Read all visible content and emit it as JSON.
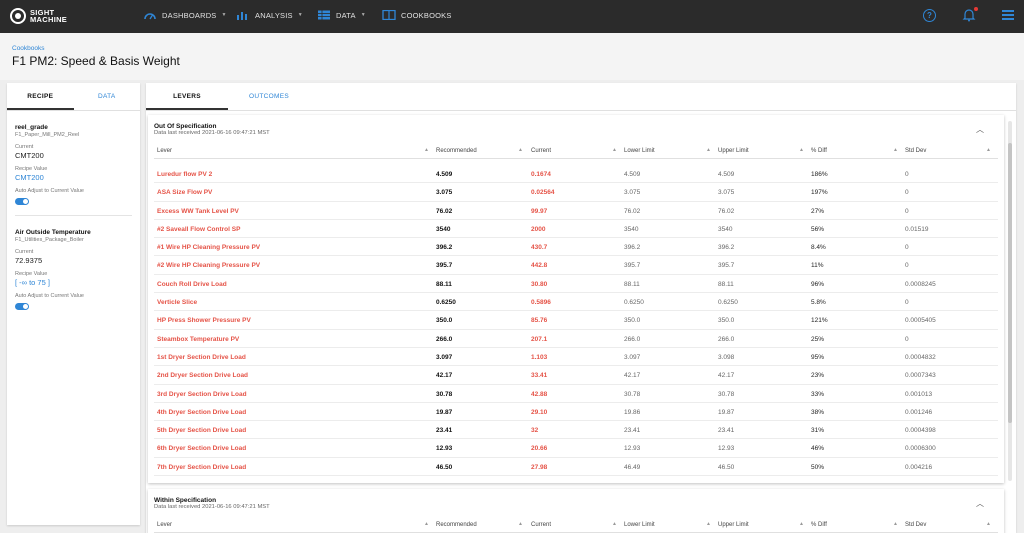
{
  "brand": {
    "line1": "SIGHT",
    "line2": "MACHINE"
  },
  "nav": [
    {
      "label": "DASHBOARDS",
      "icon": "gauge-icon",
      "caret": true
    },
    {
      "label": "ANALYSIS",
      "icon": "bar-chart-icon",
      "caret": true
    },
    {
      "label": "DATA",
      "icon": "table-icon",
      "caret": true
    },
    {
      "label": "COOKBOOKS",
      "icon": "book-icon",
      "caret": false
    }
  ],
  "topbar_icons": {
    "help": "?"
  },
  "breadcrumb": "Cookbooks",
  "page_title": "F1 PM2: Speed & Basis Weight",
  "left_tabs": {
    "recipe": "RECIPE",
    "data": "DATA"
  },
  "recipes": [
    {
      "name": "reel_grade",
      "source": "F1_Paper_Mill_PM2_Reel",
      "current_label": "Current",
      "current": "CMT200",
      "recipe_label": "Recipe Value",
      "recipe_value": "CMT200",
      "auto_label": "Auto Adjust to Current Value",
      "auto_on": true
    },
    {
      "name": "Air Outside Temperature",
      "source": "F1_Utilities_Package_Boiler",
      "current_label": "Current",
      "current": "72.9375",
      "recipe_label": "Recipe Value",
      "recipe_value": "[ -∞ to 75 ]",
      "auto_label": "Auto Adjust to Current Value",
      "auto_on": true
    }
  ],
  "main_tabs": {
    "levers": "LEVERS",
    "outcomes": "OUTCOMES"
  },
  "columns": [
    "Lever",
    "Recommended",
    "Current",
    "Lower Limit",
    "Upper Limit",
    "% Diff",
    "Std Dev"
  ],
  "out_spec": {
    "title": "Out Of Specification",
    "subtitle": "Data last received 2021-06-16 09:47:21 MST",
    "rows": [
      [
        "Luredur flow PV 2",
        "4.509",
        "0.1674",
        "4.509",
        "4.509",
        "186%",
        "0"
      ],
      [
        "ASA Size Flow PV",
        "3.075",
        "0.02564",
        "3.075",
        "3.075",
        "197%",
        "0"
      ],
      [
        "Excess WW Tank Level PV",
        "76.02",
        "99.97",
        "76.02",
        "76.02",
        "27%",
        "0"
      ],
      [
        "#2 Saveall Flow Control SP",
        "3540",
        "2000",
        "3540",
        "3540",
        "56%",
        "0.01519"
      ],
      [
        "#1 Wire HP Cleaning Pressure PV",
        "396.2",
        "430.7",
        "396.2",
        "396.2",
        "8.4%",
        "0"
      ],
      [
        "#2 Wire HP Cleaning Pressure PV",
        "395.7",
        "442.8",
        "395.7",
        "395.7",
        "11%",
        "0"
      ],
      [
        "Couch Roll Drive Load",
        "88.11",
        "30.80",
        "88.11",
        "88.11",
        "96%",
        "0.0008245"
      ],
      [
        "Verticle Slice",
        "0.6250",
        "0.5896",
        "0.6250",
        "0.6250",
        "5.8%",
        "0"
      ],
      [
        "HP Press Shower Pressure PV",
        "350.0",
        "85.76",
        "350.0",
        "350.0",
        "121%",
        "0.0005405"
      ],
      [
        "Steambox Temperature PV",
        "266.0",
        "207.1",
        "266.0",
        "266.0",
        "25%",
        "0"
      ],
      [
        "1st Dryer Section Drive Load",
        "3.097",
        "1.103",
        "3.097",
        "3.098",
        "95%",
        "0.0004832"
      ],
      [
        "2nd Dryer Section Drive Load",
        "42.17",
        "33.41",
        "42.17",
        "42.17",
        "23%",
        "0.0007343"
      ],
      [
        "3rd Dryer Section Drive Load",
        "30.78",
        "42.88",
        "30.78",
        "30.78",
        "33%",
        "0.001013"
      ],
      [
        "4th Dryer Section Drive Load",
        "19.87",
        "29.10",
        "19.86",
        "19.87",
        "38%",
        "0.001246"
      ],
      [
        "5th Dryer Section Drive Load",
        "23.41",
        "32",
        "23.41",
        "23.41",
        "31%",
        "0.0004398"
      ],
      [
        "6th Dryer Section Drive Load",
        "12.93",
        "20.66",
        "12.93",
        "12.93",
        "46%",
        "0.0006300"
      ],
      [
        "7th Dryer Section Drive Load",
        "46.50",
        "27.98",
        "46.49",
        "46.50",
        "50%",
        "0.004216"
      ]
    ]
  },
  "in_spec": {
    "title": "Within Specification",
    "subtitle": "Data last received 2021-06-16 09:47:21 MST"
  }
}
